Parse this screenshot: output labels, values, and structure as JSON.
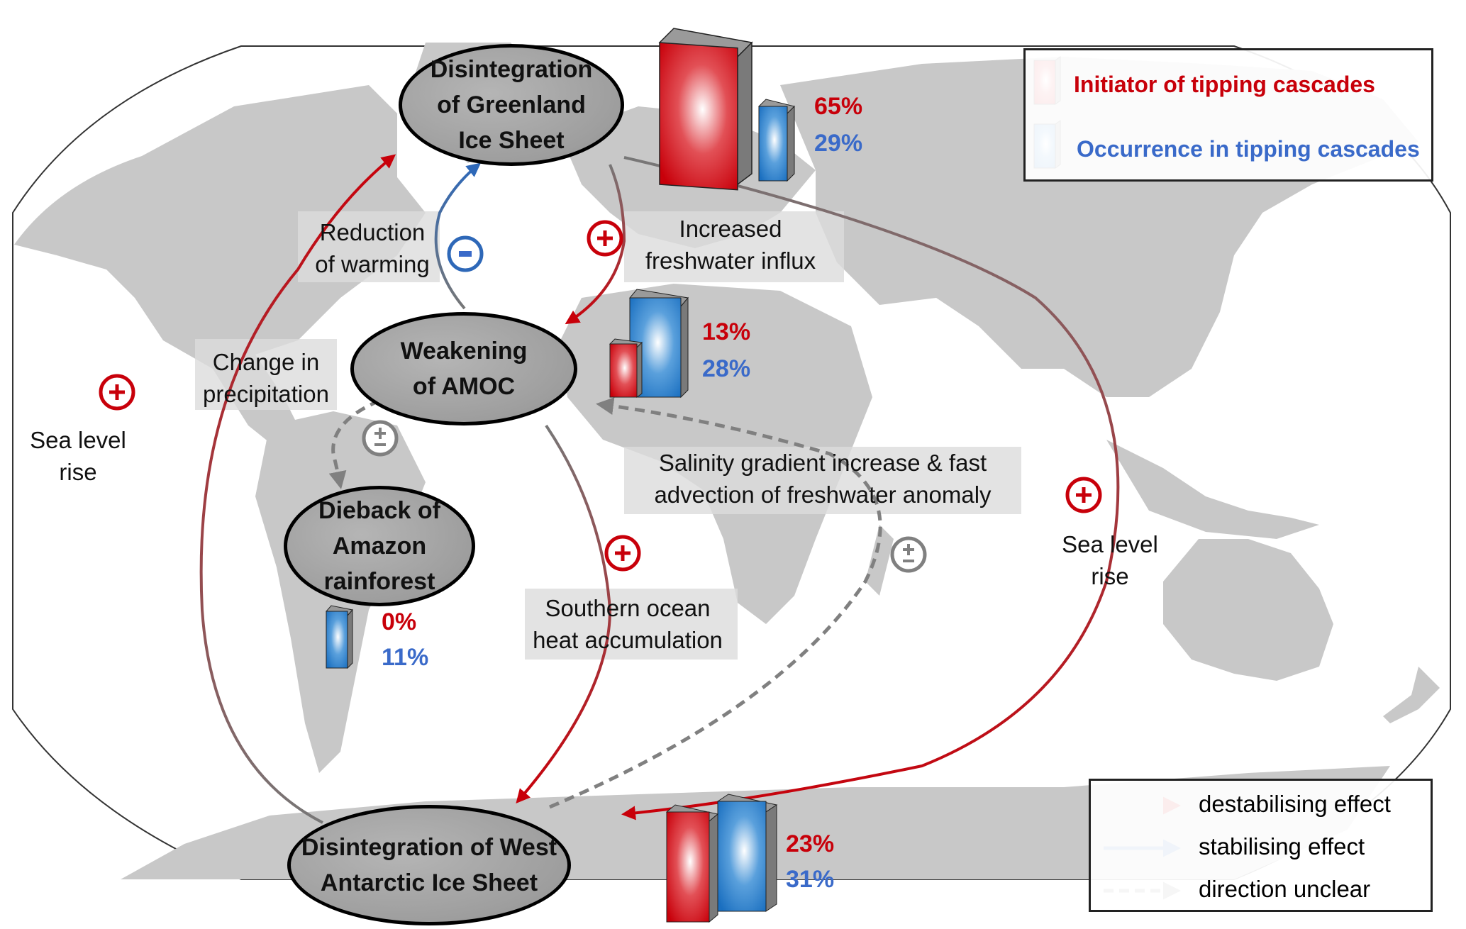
{
  "colors": {
    "destabilising": "#c8000a",
    "stabilising": "#2e68b8",
    "unclear": "#808080",
    "land": "#c8c8c8",
    "initiator": "#c8000a",
    "occurrence": "#3a6ac9"
  },
  "nodes": {
    "greenland": {
      "label": "Disintegration\nof Greenland\nIce Sheet",
      "initiator_pct": "65%",
      "occurrence_pct": "29%"
    },
    "amoc": {
      "label": "Weakening\nof AMOC",
      "initiator_pct": "13%",
      "occurrence_pct": "28%"
    },
    "amazon": {
      "label": "Dieback of\nAmazon\nrainforest",
      "initiator_pct": "0%",
      "occurrence_pct": "11%"
    },
    "wais": {
      "label": "Disintegration of West\nAntarctic Ice Sheet",
      "initiator_pct": "23%",
      "occurrence_pct": "31%"
    }
  },
  "links": {
    "reduction_of_warming": {
      "text": "Reduction\nof warming",
      "sign": "minus"
    },
    "freshwater_influx": {
      "text": "Increased\nfreshwater influx",
      "sign": "plus"
    },
    "change_precipitation": {
      "text": "Change in\nprecipitation",
      "sign": "plus-minus"
    },
    "sea_level_left": {
      "text": "Sea level\nrise",
      "sign": "plus"
    },
    "sea_level_right": {
      "text": "Sea level\nrise",
      "sign": "plus"
    },
    "southern_ocean": {
      "text": "Southern ocean\nheat accumulation",
      "sign": "plus"
    },
    "salinity": {
      "text": "Salinity gradient increase & fast\nadvection of freshwater anomaly",
      "sign": "plus-minus"
    }
  },
  "domino_legend": {
    "initiator_label": "Initiator of tipping cascades",
    "occurrence_label": "Occurrence in tipping cascades"
  },
  "arrow_legend": {
    "destabilising_label": "destabilising effect",
    "stabilising_label": "stabilising effect",
    "unclear_label": "direction unclear"
  },
  "signs": {
    "plus": "+",
    "minus": "−",
    "plus_minus": "±"
  }
}
